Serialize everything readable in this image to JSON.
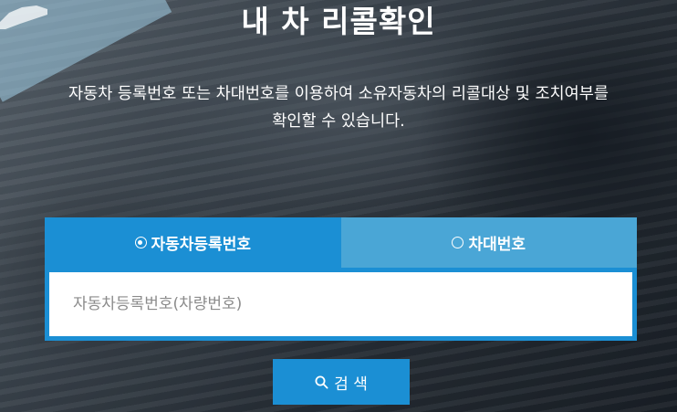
{
  "header": {
    "title": "내 차 리콜확인",
    "description_line1": "자동차 등록번호 또는 차대번호를 이용하여 소유자동차의 리콜대상 및 조치여부를",
    "description_line2": "확인할 수 있습니다."
  },
  "tabs": [
    {
      "label": "자동차등록번호",
      "selected": true
    },
    {
      "label": "차대번호",
      "selected": false
    }
  ],
  "search": {
    "placeholder": "자동차등록번호(차량번호)",
    "value": "",
    "button_label": "검 색"
  },
  "colors": {
    "primary": "#1b8fd4",
    "tab_inactive": "#4aa6d6",
    "text_on_primary": "#ffffff",
    "placeholder": "#8b8b8b"
  },
  "icons": {
    "search_button": "search-icon",
    "corner": "car-silhouette-icon"
  }
}
